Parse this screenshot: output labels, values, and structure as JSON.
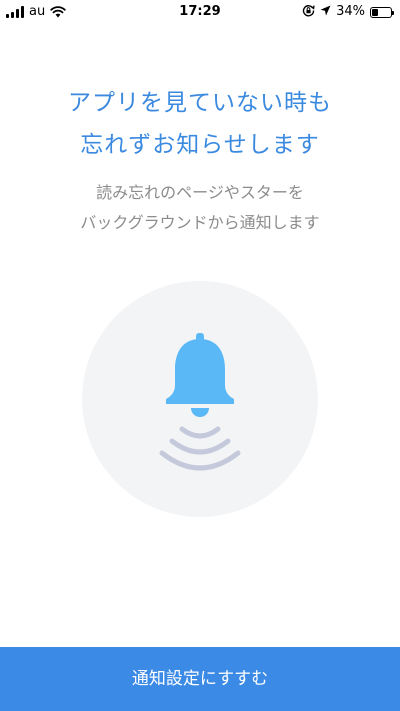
{
  "status_bar": {
    "carrier": "au",
    "time": "17:29",
    "battery_percent_label": "34%",
    "battery_level": 0.34,
    "icons": [
      "signal-icon",
      "wifi-icon",
      "rotation-lock-icon",
      "location-arrow-icon",
      "battery-icon"
    ]
  },
  "main": {
    "headline_line1": "アプリを見ていない時も",
    "headline_line2": "忘れずお知らせします",
    "subtext_line1": "読み忘れのページやスターを",
    "subtext_line2": "バックグラウンドから通知します",
    "illustration_icon": "bell-icon",
    "accent_color": "#3b8ae6",
    "bell_color": "#5ab8f7",
    "wave_color": "#c4c9dc"
  },
  "footer": {
    "button_label": "通知設定にすすむ"
  }
}
